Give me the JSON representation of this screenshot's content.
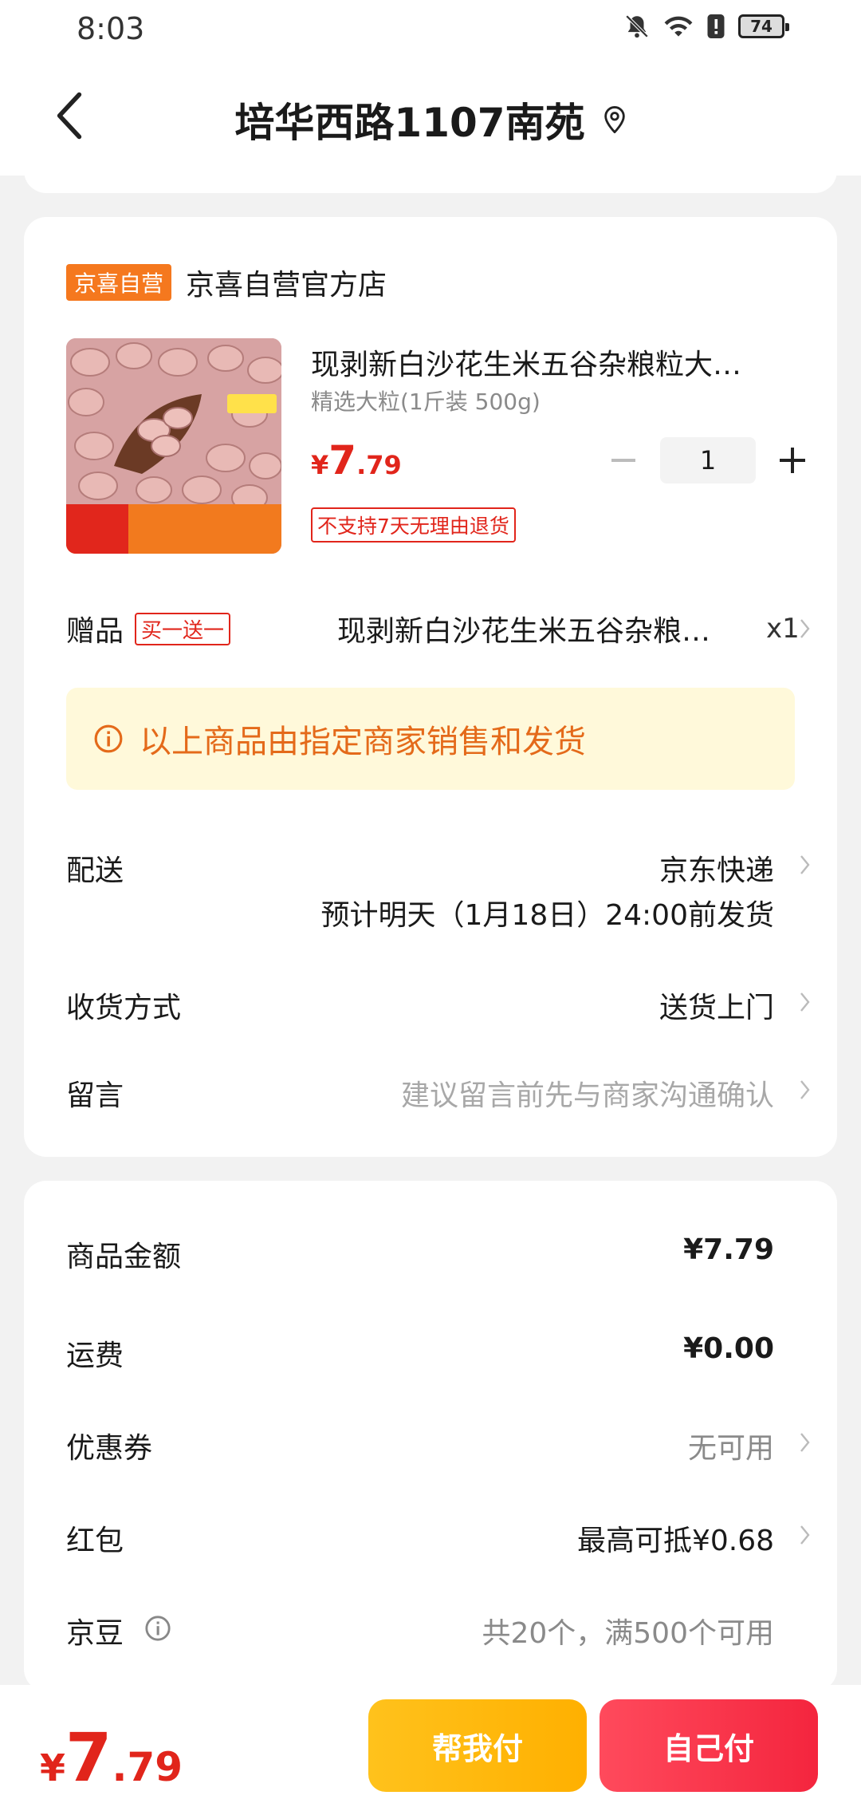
{
  "status_bar": {
    "time": "8:03",
    "battery": "74"
  },
  "header": {
    "title": "培华西路1107南苑"
  },
  "store": {
    "badge": "京喜自营",
    "name": "京喜自营官方店"
  },
  "product": {
    "name": "现剥新白沙花生米五谷杂粮粒大…",
    "spec": "精选大粒(1斤装 500g)",
    "price_currency": "¥",
    "price_int": "7",
    "price_dec": ".79",
    "quantity": "1",
    "return_policy": "不支持7天无理由退货"
  },
  "gift": {
    "label": "赠品",
    "tag": "买一送一",
    "name": "现剥新白沙花生米五谷杂粮…",
    "qty": "x1"
  },
  "notice": {
    "text": "以上商品由指定商家销售和发货"
  },
  "delivery": {
    "label": "配送",
    "value": "京东快递",
    "eta": "预计明天（1月18日）24:00前发货"
  },
  "receive": {
    "label": "收货方式",
    "value": "送货上门"
  },
  "message": {
    "label": "留言",
    "placeholder": "建议留言前先与商家沟通确认"
  },
  "summary": {
    "goods_label": "商品金额",
    "goods_value": "¥7.79",
    "shipping_label": "运费",
    "shipping_value": "¥0.00",
    "coupon_label": "优惠券",
    "coupon_value": "无可用",
    "redpacket_label": "红包",
    "redpacket_value": "最高可抵¥0.68",
    "jingdou_label": "京豆",
    "jingdou_value": "共20个，满500个可用"
  },
  "bottom": {
    "total_currency": "¥",
    "total_int": "7",
    "total_dec": ".79",
    "help_pay": "帮我付",
    "self_pay": "自己付"
  },
  "colors": {
    "accent_red": "#e1251b",
    "accent_orange": "#f5781e",
    "notice_bg": "#fff9da",
    "help_btn": "#ffb000",
    "self_btn": "#f4253e"
  }
}
